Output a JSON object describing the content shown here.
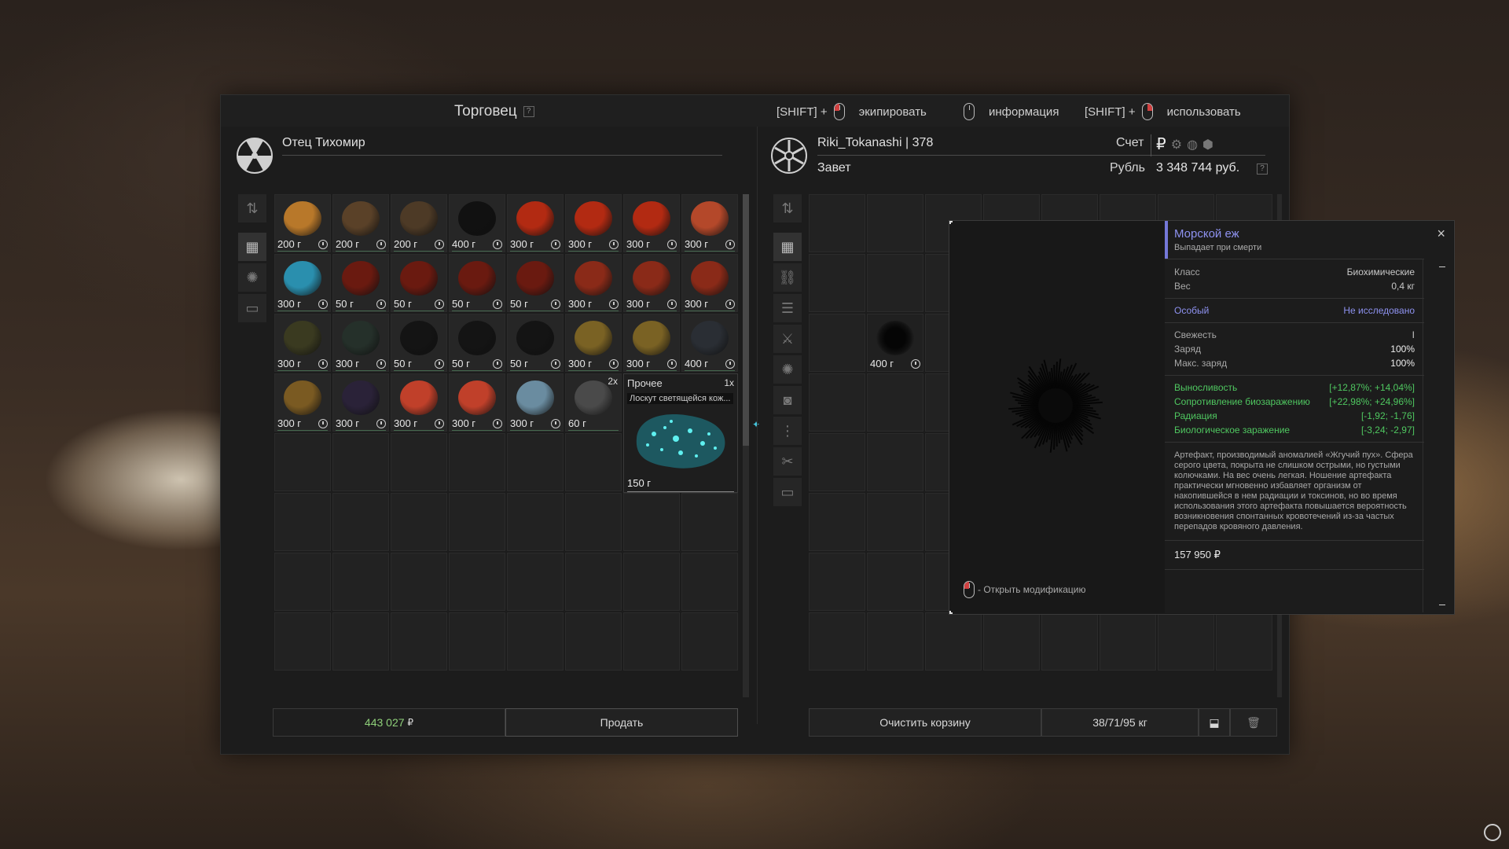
{
  "trader": {
    "title": "Торговец",
    "help": "?",
    "name": "Отец Тихомир"
  },
  "hints": [
    {
      "prefix": "[SHIFT] +",
      "label": "экипировать",
      "mouse": "left"
    },
    {
      "prefix": "",
      "label": "информация",
      "mouse": "none"
    },
    {
      "prefix": "[SHIFT] +",
      "label": "использовать",
      "mouse": "right"
    }
  ],
  "player": {
    "name": "Riki_Tokanashi | 378",
    "faction": "Завет",
    "account_label": "Счет",
    "currency_label": "Рубль",
    "balance": "3 348 744 руб.",
    "help": "?"
  },
  "trader_items": [
    {
      "price": "200 г",
      "color": "#b8782a"
    },
    {
      "price": "200 г",
      "color": "#5a4128"
    },
    {
      "price": "200 г",
      "color": "#4d3a26"
    },
    {
      "price": "400 г",
      "color": "#111111"
    },
    {
      "price": "300 г",
      "color": "#b22a12"
    },
    {
      "price": "300 г",
      "color": "#b22a12"
    },
    {
      "price": "300 г",
      "color": "#b22a12"
    },
    {
      "price": "300 г",
      "color": "#b4482a"
    },
    {
      "price": "300 г",
      "color": "#2a8fae"
    },
    {
      "price": "50 г",
      "color": "#6a1a10"
    },
    {
      "price": "50 г",
      "color": "#6a1a10"
    },
    {
      "price": "50 г",
      "color": "#6a1a10"
    },
    {
      "price": "50 г",
      "color": "#6a1a10"
    },
    {
      "price": "300 г",
      "color": "#8a2a18"
    },
    {
      "price": "300 г",
      "color": "#8a2a18"
    },
    {
      "price": "300 г",
      "color": "#8a2a18"
    },
    {
      "price": "300 г",
      "color": "#3a3a20"
    },
    {
      "price": "300 г",
      "color": "#25302a"
    },
    {
      "price": "50 г",
      "color": "#141414"
    },
    {
      "price": "50 г",
      "color": "#141414"
    },
    {
      "price": "50 г",
      "color": "#141414"
    },
    {
      "price": "300 г",
      "color": "#7a6224"
    },
    {
      "price": "300 г",
      "color": "#7a6224"
    },
    {
      "price": "400 г",
      "color": "#2a2e34"
    },
    {
      "price": "300 г",
      "color": "#7a5a22"
    },
    {
      "price": "300 г",
      "color": "#2a2238"
    },
    {
      "price": "300 г",
      "color": "#c0402a"
    },
    {
      "price": "300 г",
      "color": "#c0402a"
    },
    {
      "price": "300 г",
      "color": "#6a8ca0"
    },
    {
      "price": "60 г",
      "color": "#4a4a4a",
      "qty": "2x"
    }
  ],
  "featured_item": {
    "category": "Прочее",
    "qty": "1x",
    "name": "Лоскут светящейся кож...",
    "price": "150 г"
  },
  "footer": {
    "money": "443 027",
    "currency_symbol": "₽",
    "sell_label": "Продать",
    "clear_label": "Очистить корзину",
    "weight": "38/71/95 кг"
  },
  "cart_item": {
    "price": "400 г"
  },
  "modal": {
    "open_mod_label": "- Открыть модификацию"
  },
  "info": {
    "title": "Морской еж",
    "subtitle": "Выпадает при смерти",
    "props": [
      {
        "label": "Класс",
        "value": "Биохимические"
      },
      {
        "label": "Вес",
        "value": "0,4 кг"
      }
    ],
    "rarity_label": "Особый",
    "rarity_value": "Не исследовано",
    "state": [
      {
        "label": "Свежесть",
        "value": "I"
      },
      {
        "label": "Заряд",
        "value": "100%"
      },
      {
        "label": "Макс. заряд",
        "value": "100%"
      }
    ],
    "stats": [
      {
        "label": "Выносливость",
        "value": "[+12,87%; +14,04%]"
      },
      {
        "label": "Сопротивление биозаражению",
        "value": "[+22,98%; +24,96%]"
      },
      {
        "label": "Радиация",
        "value": "[-1,92; -1,76]"
      },
      {
        "label": "Биологическое заражение",
        "value": "[-3,24; -2,97]"
      }
    ],
    "description": "Артефакт, производимый аномалией «Жгучий пух». Сфера серого цвета, покрыта не слишком острыми, но густыми колючками. На вес очень легкая. Ношение артефакта практически мгновенно избавляет организм от накопившейся в нем радиации и токсинов, но во время использования этого артефакта повышается вероятность возникновения спонтанных кровотечений из-за частых перепадов кровяного давления.",
    "price": "157 950 ₽",
    "close": "×"
  },
  "colors": {
    "accent": "#7478d8",
    "positive": "#4fc760",
    "money": "#8fd07a"
  }
}
